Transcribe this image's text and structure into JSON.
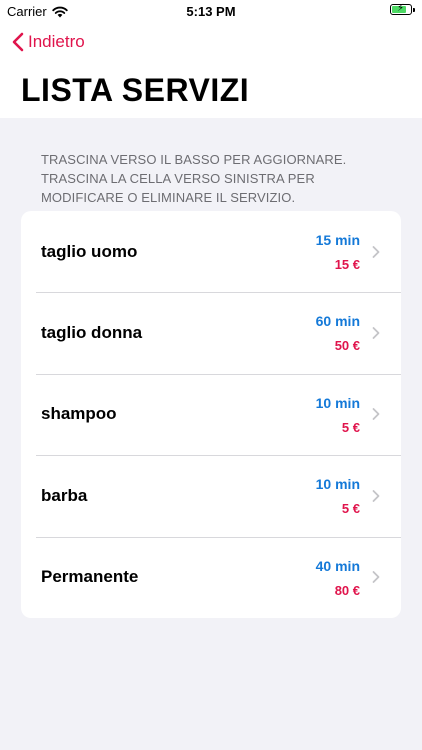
{
  "status_bar": {
    "carrier": "Carrier",
    "time": "5:13 PM",
    "battery_level": 0.8,
    "charging": true
  },
  "nav": {
    "back_label": "Indietro",
    "title": "LISTA SERVIZI"
  },
  "hint": "TRASCINA VERSO IL BASSO PER AGGIORNARE.\nTRASCINA LA CELLA VERSO SINISTRA PER MODIFICARE O ELIMINARE IL SERVIZIO.",
  "colors": {
    "accent": "#e0144c",
    "duration": "#1479d8",
    "price": "#e0144c",
    "background": "#f2f2f7"
  },
  "services": [
    {
      "name": "taglio uomo",
      "duration": "15 min",
      "price": "15 €"
    },
    {
      "name": "taglio donna",
      "duration": "60 min",
      "price": "50 €"
    },
    {
      "name": "shampoo",
      "duration": "10 min",
      "price": "5 €"
    },
    {
      "name": "barba",
      "duration": "10 min",
      "price": "5 €"
    },
    {
      "name": "Permanente",
      "duration": "40 min",
      "price": "80 €"
    }
  ]
}
